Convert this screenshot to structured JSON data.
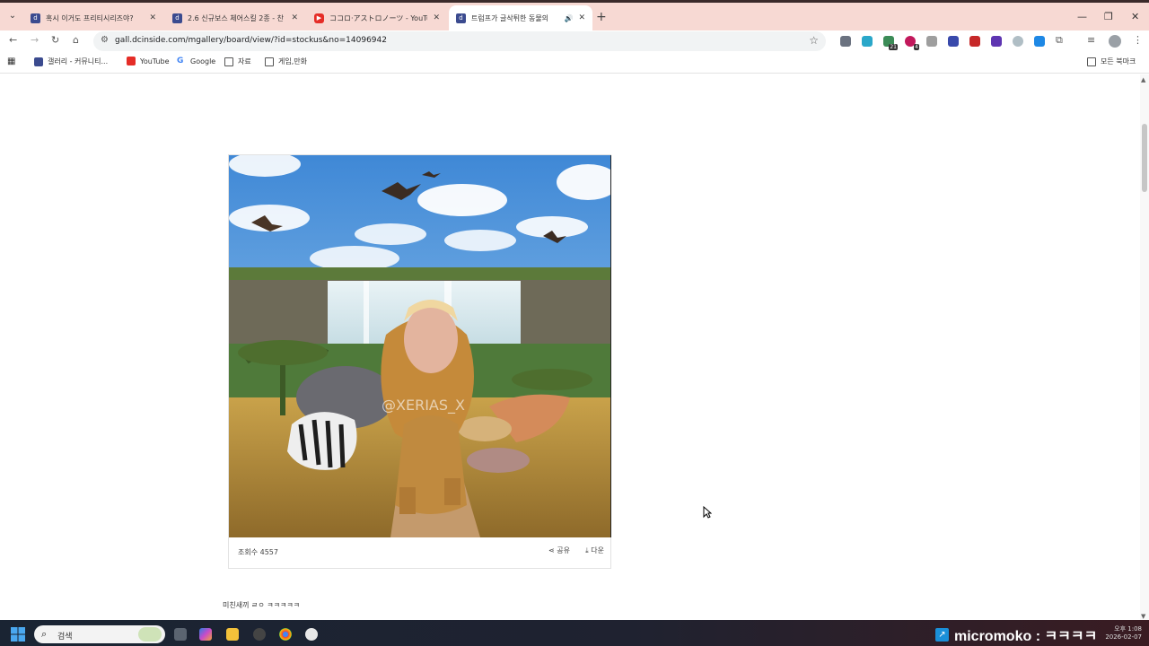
{
  "browser": {
    "tabs": [
      {
        "title": "혹시 이거도 프리티시리즈야?",
        "favicon": "dcinside-icon",
        "active": false
      },
      {
        "title": "2.6 신규보스 체어스킬 2종 - 찬",
        "favicon": "dcinside-icon",
        "active": false
      },
      {
        "title": "ココロ·アストロノーツ - YouTube",
        "favicon": "youtube-icon",
        "active": false
      },
      {
        "title": "트럼프가 글삭튀한 동물의",
        "favicon": "dcinside-icon",
        "active": true
      }
    ],
    "url": "gall.dcinside.com/mgallery/board/view/?id=stockus&no=14096942",
    "extension_badges": [
      "21",
      "4"
    ]
  },
  "bookmarks": [
    {
      "label": "갤러리 - 커뮤니티...",
      "icon": "dcinside-icon"
    },
    {
      "label": "YouTube",
      "icon": "youtube-icon"
    },
    {
      "label": "Google",
      "icon": "google-icon"
    },
    {
      "label": "자료",
      "icon": "folder-icon"
    },
    {
      "label": "게임,만화",
      "icon": "folder-icon"
    }
  ],
  "all_bookmarks_label": "모든 북마크",
  "post": {
    "image_watermark": "@XERIAS_X",
    "views_label": "조회수 4557",
    "share_label": "공유",
    "download_label": "다운",
    "comment_text": "미친새끼 ㄹㅇ ㅋㅋㅋㅋㅋ"
  },
  "taskbar": {
    "search_placeholder": "검색",
    "stream_overlay": "micromoko : ㅋㅋㅋㅋ",
    "clock_time": "오후 1:08",
    "clock_date": "2026-02-07"
  },
  "colors": {
    "tabstrip_bg": "#f7d9d3",
    "dc_brand": "#3b4b8f",
    "youtube_red": "#e52d27"
  }
}
